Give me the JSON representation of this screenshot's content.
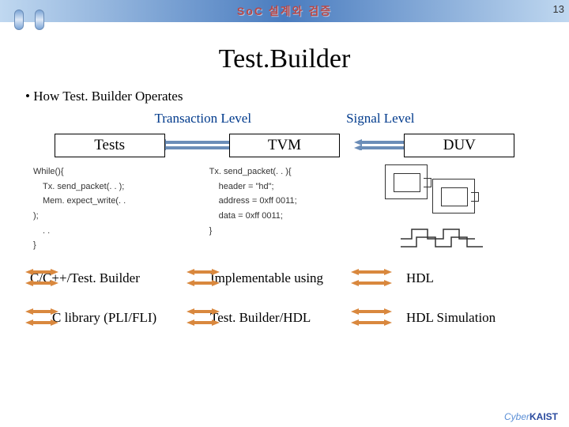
{
  "header": {
    "title": "SoC 설계와 검증",
    "page_number": "13"
  },
  "main": {
    "title": "Test.Builder",
    "bullet": "How Test. Builder Operates",
    "levels": {
      "transaction": "Transaction Level",
      "signal": "Signal Level"
    },
    "boxes": {
      "tests": "Tests",
      "tvm": "TVM",
      "duv": "DUV"
    },
    "code_tests": {
      "l0": "While(){",
      "l1": "Tx. send_packet(. . );",
      "l2": "Mem. expect_write(. .",
      "l3": ");",
      "l4": ". .",
      "l5": "}"
    },
    "code_tvm": {
      "l0": "Tx. send_packet(. . ){",
      "l1": "header = \"hd\";",
      "l2": "address = 0xff 0011;",
      "l3": "data = 0xff 0011;",
      "l4": "}"
    },
    "bottom": {
      "c_cpp": "C/C++/Test. Builder",
      "implementable": "Implementable using",
      "hdl": "HDL",
      "c_library": "C library (PLI/FLI)",
      "tb_hdl": "Test. Builder/HDL",
      "hdl_sim": "HDL Simulation"
    }
  },
  "footer": {
    "logo_prefix": "Cyber",
    "logo_main": "KAIST"
  },
  "chart_data": {
    "type": "diagram",
    "nodes": [
      {
        "id": "tests",
        "label": "Tests"
      },
      {
        "id": "tvm",
        "label": "TVM"
      },
      {
        "id": "duv",
        "label": "DUV"
      }
    ],
    "edges": [
      {
        "from": "tests",
        "to": "tvm",
        "bidirectional": true,
        "level": "Transaction Level"
      },
      {
        "from": "tvm",
        "to": "duv",
        "bidirectional": true,
        "level": "Signal Level"
      }
    ],
    "annotations": {
      "tests_code": [
        "While(){",
        "Tx. send_packet(. . );",
        "Mem. expect_write(. .",
        ");",
        ". .",
        "}"
      ],
      "tvm_code": [
        "Tx. send_packet(. . ){",
        "header = \"hd\";",
        "address = 0xff 0011;",
        "data = 0xff 0011;",
        "}"
      ]
    },
    "bottom_flows": [
      {
        "from": "C/C++/Test. Builder",
        "to": "Implementable using",
        "to2": "HDL",
        "bidirectional": true
      },
      {
        "from": "C library (PLI/FLI)",
        "to": "Test. Builder/HDL",
        "to2": "HDL Simulation",
        "bidirectional": true
      }
    ]
  }
}
